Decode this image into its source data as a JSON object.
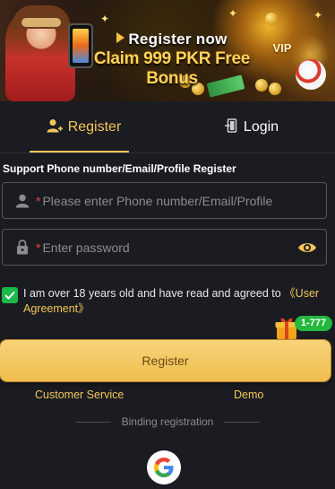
{
  "banner": {
    "headline": "Register now",
    "promo": "Claim 999 PKR Free Bonus",
    "vip_badge": "VIP"
  },
  "tabs": [
    {
      "label": "Register",
      "active": true,
      "icon": "user-add-icon"
    },
    {
      "label": "Login",
      "active": false,
      "icon": "door-exit-icon"
    }
  ],
  "form": {
    "support_text": "Support Phone number/Email/Profile Register",
    "phone": {
      "required_mark": "*",
      "placeholder": "Please enter Phone number/Email/Profile",
      "value": "",
      "icon": "user-icon"
    },
    "password": {
      "required_mark": "*",
      "placeholder": "Enter password",
      "value": "",
      "icon": "lock-icon",
      "toggle_icon": "eye-icon"
    },
    "agreement": {
      "checked": true,
      "text": "I am over 18 years old and have read and agreed to ",
      "link": "《User Agreement》"
    },
    "gift_badge": "1-777",
    "submit_label": "Register"
  },
  "links": {
    "customer_service": "Customer Service",
    "demo": "Demo"
  },
  "binding": {
    "label": "Binding registration",
    "providers": [
      "google-icon"
    ]
  },
  "colors": {
    "background": "#1b1c21",
    "accent": "#f4c65a",
    "button": "#efbd50",
    "success": "#1bb84a"
  }
}
